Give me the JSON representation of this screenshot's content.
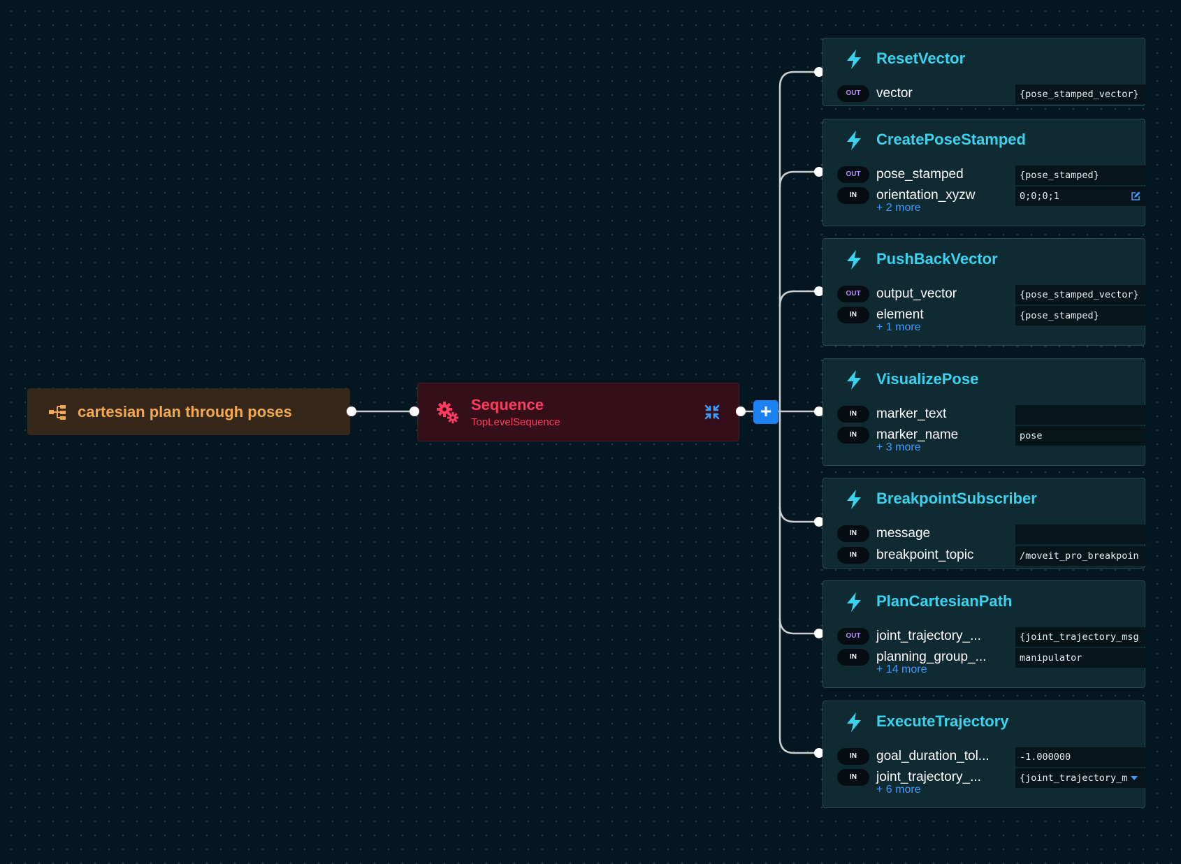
{
  "root": {
    "label": "cartesian plan through poses",
    "icon": "tree-icon"
  },
  "sequence": {
    "title": "Sequence",
    "subtitle": "TopLevelSequence",
    "icon": "gears-icon",
    "collapse_icon": "collapse-icon"
  },
  "add_button": {
    "label": "+"
  },
  "colors": {
    "root_accent": "#f5a94e",
    "sequence_accent": "#ff3b5e",
    "action_accent": "#3ad3ef",
    "link": "#3a9cff",
    "add_button": "#1c82f2"
  },
  "nodes": [
    {
      "title": "ResetVector",
      "ports": [
        {
          "dir": "OUT",
          "name": "vector",
          "value": "{pose_stamped_vector}"
        }
      ],
      "more": ""
    },
    {
      "title": "CreatePoseStamped",
      "ports": [
        {
          "dir": "OUT",
          "name": "pose_stamped",
          "value": "{pose_stamped}"
        },
        {
          "dir": "IN",
          "name": "orientation_xyzw",
          "value": "0;0;0;1"
        }
      ],
      "more": "+ 2 more"
    },
    {
      "title": "PushBackVector",
      "ports": [
        {
          "dir": "OUT",
          "name": "output_vector",
          "value": "{pose_stamped_vector}"
        },
        {
          "dir": "IN",
          "name": "element",
          "value": "{pose_stamped}"
        }
      ],
      "more": "+ 1 more"
    },
    {
      "title": "VisualizePose",
      "ports": [
        {
          "dir": "IN",
          "name": "marker_text",
          "value": ""
        },
        {
          "dir": "IN",
          "name": "marker_name",
          "value": "pose"
        }
      ],
      "more": "+ 3 more"
    },
    {
      "title": "BreakpointSubscriber",
      "ports": [
        {
          "dir": "IN",
          "name": "message",
          "value": ""
        },
        {
          "dir": "IN",
          "name": "breakpoint_topic",
          "value": "/moveit_pro_breakpoin"
        }
      ],
      "more": ""
    },
    {
      "title": "PlanCartesianPath",
      "ports": [
        {
          "dir": "OUT",
          "name": "joint_trajectory_...",
          "value": "{joint_trajectory_msg"
        },
        {
          "dir": "IN",
          "name": "planning_group_...",
          "value": "manipulator"
        }
      ],
      "more": "+ 14 more"
    },
    {
      "title": "ExecuteTrajectory",
      "ports": [
        {
          "dir": "IN",
          "name": "goal_duration_tol...",
          "value": "-1.000000"
        },
        {
          "dir": "IN",
          "name": "joint_trajectory_...",
          "value": "{joint_trajectory_m"
        }
      ],
      "more": "+ 6 more"
    }
  ]
}
